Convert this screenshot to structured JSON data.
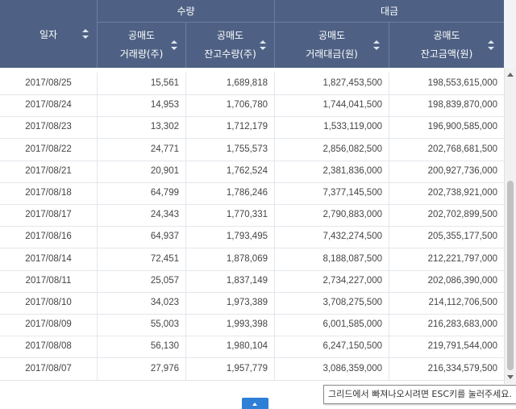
{
  "header": {
    "date_label": "일자",
    "group_volume": "수량",
    "group_amount": "대금",
    "cols": [
      {
        "line1": "공매도",
        "line2": "거래량(주)"
      },
      {
        "line1": "공매도",
        "line2": "잔고수량(주)"
      },
      {
        "line1": "공매도",
        "line2": "거래대금(원)"
      },
      {
        "line1": "공매도",
        "line2": "잔고금액(원)"
      }
    ]
  },
  "rows": [
    {
      "date": "2017/08/25",
      "trade_vol": "15,561",
      "balance_qty": "1,689,818",
      "trade_amt": "1,827,453,500",
      "balance_amt": "198,553,615,000"
    },
    {
      "date": "2017/08/24",
      "trade_vol": "14,953",
      "balance_qty": "1,706,780",
      "trade_amt": "1,744,041,500",
      "balance_amt": "198,839,870,000"
    },
    {
      "date": "2017/08/23",
      "trade_vol": "13,302",
      "balance_qty": "1,712,179",
      "trade_amt": "1,533,119,000",
      "balance_amt": "196,900,585,000"
    },
    {
      "date": "2017/08/22",
      "trade_vol": "24,771",
      "balance_qty": "1,755,573",
      "trade_amt": "2,856,082,500",
      "balance_amt": "202,768,681,500"
    },
    {
      "date": "2017/08/21",
      "trade_vol": "20,901",
      "balance_qty": "1,762,524",
      "trade_amt": "2,381,836,000",
      "balance_amt": "200,927,736,000"
    },
    {
      "date": "2017/08/18",
      "trade_vol": "64,799",
      "balance_qty": "1,786,246",
      "trade_amt": "7,377,145,500",
      "balance_amt": "202,738,921,000"
    },
    {
      "date": "2017/08/17",
      "trade_vol": "24,343",
      "balance_qty": "1,770,331",
      "trade_amt": "2,790,883,000",
      "balance_amt": "202,702,899,500"
    },
    {
      "date": "2017/08/16",
      "trade_vol": "64,937",
      "balance_qty": "1,793,495",
      "trade_amt": "7,432,274,500",
      "balance_amt": "205,355,177,500"
    },
    {
      "date": "2017/08/14",
      "trade_vol": "72,451",
      "balance_qty": "1,878,069",
      "trade_amt": "8,188,087,500",
      "balance_amt": "212,221,797,000"
    },
    {
      "date": "2017/08/11",
      "trade_vol": "25,057",
      "balance_qty": "1,837,149",
      "trade_amt": "2,734,227,000",
      "balance_amt": "202,086,390,000"
    },
    {
      "date": "2017/08/10",
      "trade_vol": "34,023",
      "balance_qty": "1,973,389",
      "trade_amt": "3,708,275,500",
      "balance_amt": "214,112,706,500"
    },
    {
      "date": "2017/08/09",
      "trade_vol": "55,003",
      "balance_qty": "1,993,398",
      "trade_amt": "6,001,585,000",
      "balance_amt": "216,283,683,000"
    },
    {
      "date": "2017/08/08",
      "trade_vol": "56,130",
      "balance_qty": "1,980,104",
      "trade_amt": "6,247,150,500",
      "balance_amt": "219,791,544,000"
    },
    {
      "date": "2017/08/07",
      "trade_vol": "27,976",
      "balance_qty": "1,957,779",
      "trade_amt": "3,086,359,000",
      "balance_amt": "216,334,579,500"
    }
  ],
  "tooltip": "그리드에서 빠져나오시려면 ESC키를 눌러주세요.",
  "icons": {
    "sort": "sort-icon",
    "scroll_up": "arrow-up-icon",
    "scroll_down": "arrow-down-icon",
    "pager": "chevron-up-icon"
  },
  "colors": {
    "header_bg": "#4e6184",
    "header_text": "#ffffff",
    "accent": "#2f7fd6"
  }
}
